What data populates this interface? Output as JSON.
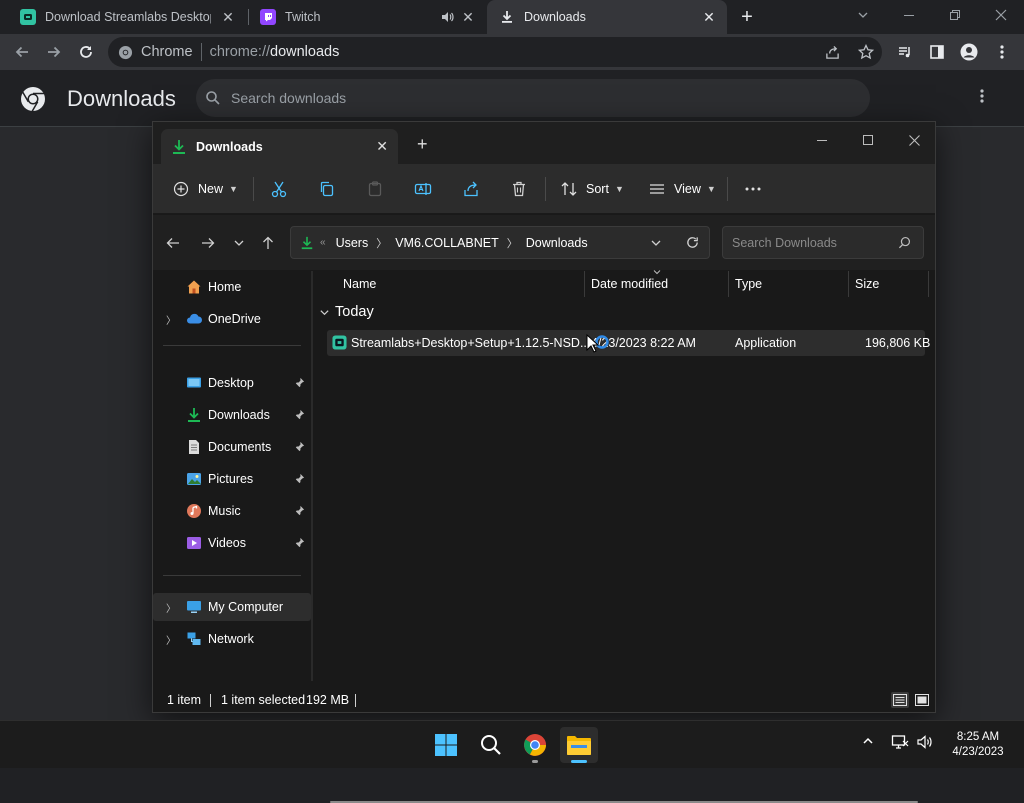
{
  "browser": {
    "tabs": [
      {
        "title": "Download Streamlabs Desktop L",
        "active": false,
        "has_close": true
      },
      {
        "title": "Twitch",
        "active": false,
        "has_close": true,
        "audio_icon": "speaker-icon"
      },
      {
        "title": "Downloads",
        "active": true,
        "has_close": true
      }
    ],
    "omnibox": {
      "site_label": "Chrome",
      "url_scheme": "chrome://",
      "url_host": "downloads"
    },
    "page": {
      "title": "Downloads",
      "search_placeholder": "Search downloads"
    }
  },
  "explorer": {
    "tab_title": "Downloads",
    "commands": {
      "new": "New",
      "sort": "Sort",
      "view": "View"
    },
    "breadcrumb": [
      "Users",
      "VM6.COLLABNET",
      "Downloads"
    ],
    "search_placeholder": "Search Downloads",
    "nav": {
      "home": "Home",
      "onedrive": "OneDrive",
      "desktop": "Desktop",
      "downloads": "Downloads",
      "documents": "Documents",
      "pictures": "Pictures",
      "music": "Music",
      "videos": "Videos",
      "my_computer": "My Computer",
      "network": "Network"
    },
    "columns": {
      "name": "Name",
      "date": "Date modified",
      "type": "Type",
      "size": "Size"
    },
    "group": "Today",
    "file": {
      "name": "Streamlabs+Desktop+Setup+1.12.5-NSD...",
      "date": "4/23/2023 8:22 AM",
      "type": "Application",
      "size": "196,806 KB"
    },
    "status": {
      "items": "1 item",
      "selected": "1 item selected",
      "size": "192 MB"
    }
  },
  "taskbar": {
    "time": "8:25 AM",
    "date": "4/23/2023"
  },
  "colors": {
    "chrome_bg": "#202124",
    "explorer_bg": "#191919",
    "accent_green": "#1db954",
    "windows_blue": "#4cc2ff"
  }
}
